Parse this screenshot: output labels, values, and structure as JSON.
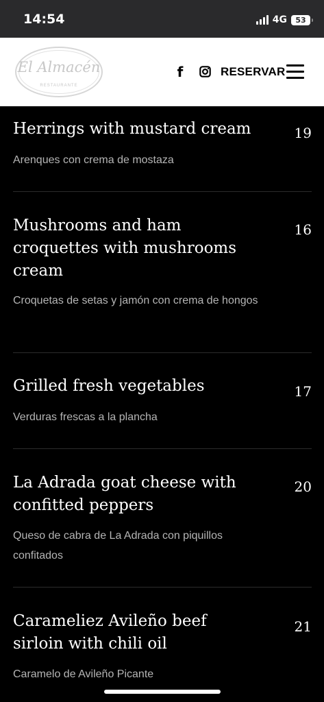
{
  "status_bar": {
    "time": "14:54",
    "network": "4G",
    "battery": "53"
  },
  "header": {
    "logo": {
      "title": "El Almacén",
      "subtitle": "RESTAURANTE"
    },
    "social": {
      "facebook_icon": "f"
    },
    "reserve_label": "RESERVAR"
  },
  "menu": {
    "items": [
      {
        "name": "Herrings with mustard cream",
        "description": "Arenques con crema de mostaza",
        "price": "19"
      },
      {
        "name": "Mushrooms and ham croquettes with mushrooms cream",
        "description": "Croquetas de setas y jamón con crema de hongos",
        "price": "16"
      },
      {
        "name": "Grilled fresh vegetables",
        "description": "Verduras frescas a la plancha",
        "price": "17"
      },
      {
        "name": "La Adrada goat cheese with confitted peppers",
        "description": "Queso de cabra de La Adrada con piquillos confitados",
        "price": "20"
      },
      {
        "name": "Carameliez Avileño beef sirloin with chili oil",
        "description": "Caramelo de Avileño Picante",
        "price": "21"
      }
    ]
  }
}
